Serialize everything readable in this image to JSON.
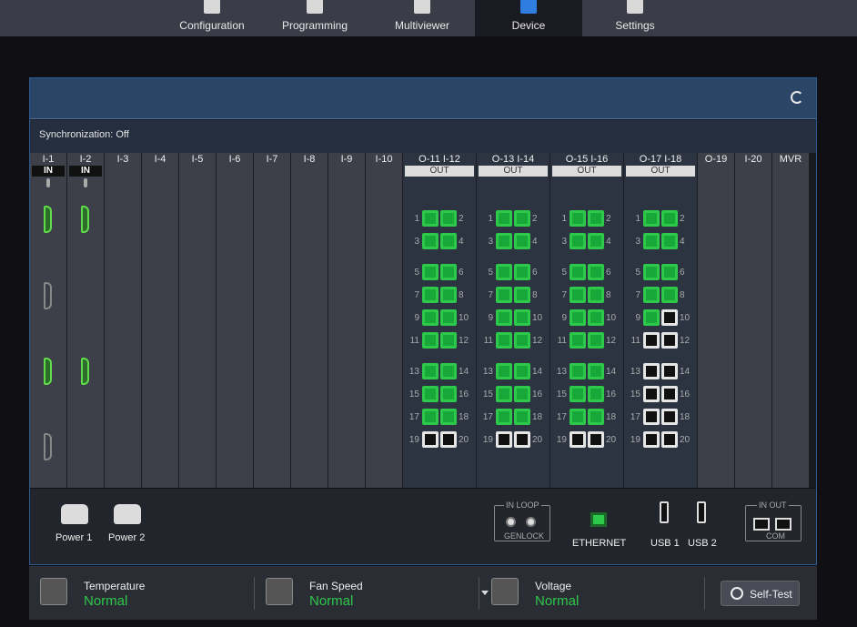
{
  "nav": {
    "tabs": [
      {
        "label": "Configuration",
        "icon": "configuration-icon",
        "active": false
      },
      {
        "label": "Programming",
        "icon": "programming-icon",
        "active": false
      },
      {
        "label": "Multiviewer",
        "icon": "multiviewer-icon",
        "active": false
      },
      {
        "label": "Device",
        "icon": "device-icon",
        "active": true
      },
      {
        "label": "Settings",
        "icon": "gear-icon",
        "active": false
      }
    ]
  },
  "panel": {
    "sync_text": "Synchronization: Off",
    "refresh_icon": "refresh-icon"
  },
  "slots": [
    {
      "label": "I-1",
      "type": "input",
      "header": "IN"
    },
    {
      "label": "I-2",
      "type": "input",
      "header": "IN"
    },
    {
      "label": "I-3",
      "type": "empty"
    },
    {
      "label": "I-4",
      "type": "empty"
    },
    {
      "label": "I-5",
      "type": "empty"
    },
    {
      "label": "I-6",
      "type": "empty"
    },
    {
      "label": "I-7",
      "type": "empty"
    },
    {
      "label": "I-8",
      "type": "empty"
    },
    {
      "label": "I-9",
      "type": "empty"
    },
    {
      "label": "I-10",
      "type": "empty"
    },
    {
      "label": "O-11   I-12",
      "type": "output",
      "header": "OUT"
    },
    {
      "label": "O-13   I-14",
      "type": "output",
      "header": "OUT"
    },
    {
      "label": "O-15   I-16",
      "type": "output",
      "header": "OUT"
    },
    {
      "label": "O-17   I-18",
      "type": "output",
      "header": "OUT"
    },
    {
      "label": "O-19",
      "type": "empty"
    },
    {
      "label": "I-20",
      "type": "empty"
    },
    {
      "label": "MVR",
      "type": "empty"
    }
  ],
  "output_ports": {
    "O-11   I-12": {
      "connected": [
        1,
        2,
        3,
        4,
        5,
        6,
        7,
        8,
        9,
        10,
        11,
        12,
        13,
        14,
        15,
        16,
        17,
        18
      ]
    },
    "O-13   I-14": {
      "connected": [
        1,
        2,
        3,
        4,
        5,
        6,
        7,
        8,
        9,
        10,
        11,
        12,
        13,
        14,
        15,
        16,
        17,
        18
      ]
    },
    "O-15   I-16": {
      "connected": [
        1,
        2,
        3,
        4,
        5,
        6,
        7,
        8,
        9,
        10,
        11,
        12,
        13,
        14,
        15,
        16,
        17,
        18
      ]
    },
    "O-17   I-18": {
      "connected": [
        1,
        2,
        3,
        4,
        5,
        6,
        7,
        8,
        9
      ]
    }
  },
  "bottom": {
    "power1": "Power 1",
    "power2": "Power 2",
    "genlock_in_loop": "IN  LOOP",
    "genlock": "GENLOCK",
    "ethernet": "ETHERNET",
    "usb1": "USB 1",
    "usb2": "USB 2",
    "com_in_out": "IN  OUT",
    "com": "COM"
  },
  "status": {
    "temperature": {
      "title": "Temperature",
      "value": "Normal",
      "icon": "thermometer-icon"
    },
    "fan": {
      "title": "Fan Speed",
      "value": "Normal",
      "icon": "fan-icon"
    },
    "voltage": {
      "title": "Voltage",
      "value": "Normal",
      "icon": "voltage-icon"
    },
    "selftest": "Self-Test"
  },
  "colors": {
    "connected": "#2ec84a",
    "accent": "#2f7de1"
  }
}
